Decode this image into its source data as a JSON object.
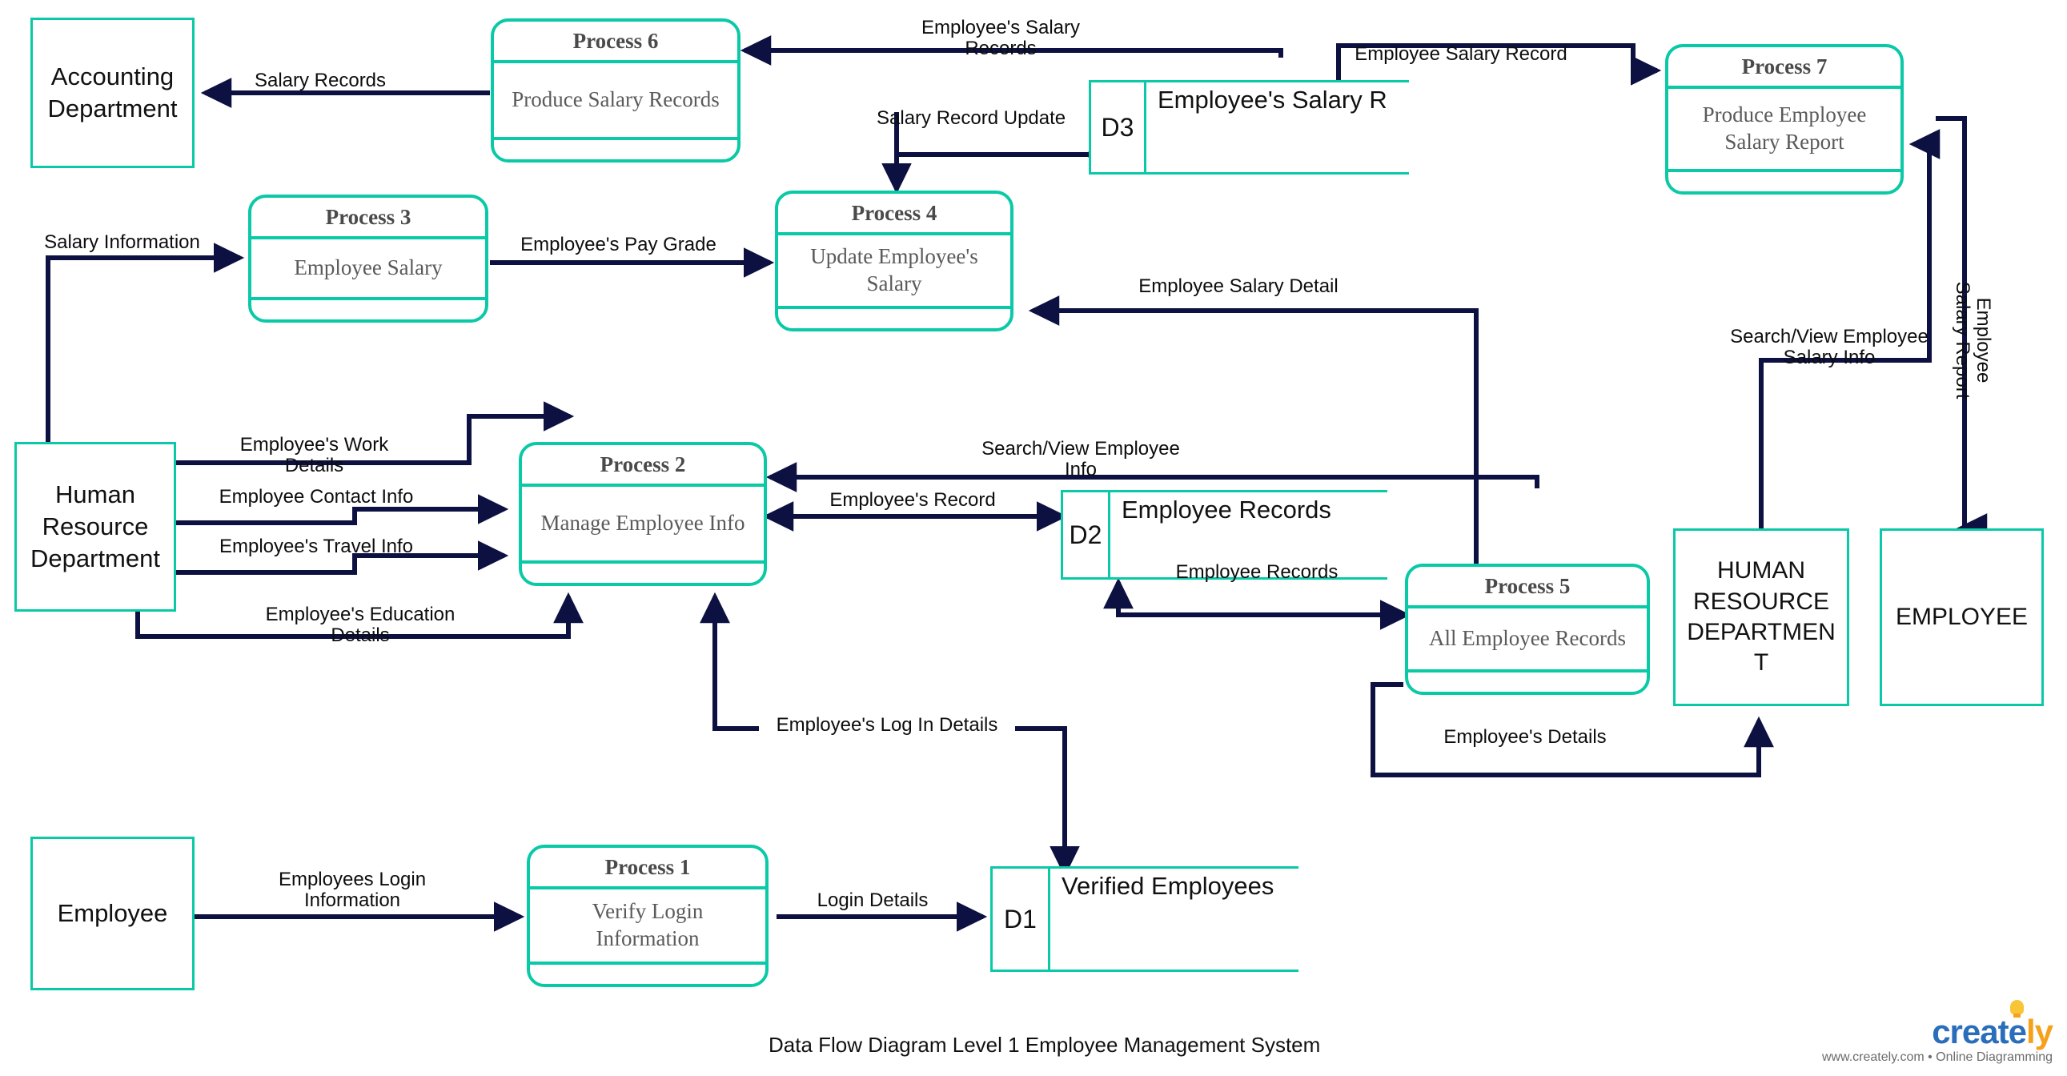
{
  "diagram": {
    "caption": "Data Flow Diagram Level 1 Employee Management System",
    "colors": {
      "shape_border": "#0ac9a6",
      "flow_line": "#0d1141",
      "process_title_text": "#4a4a4a",
      "process_body_text": "#5a5a5a",
      "label_text": "#0d0d0d",
      "background": "#ffffff"
    }
  },
  "entities": [
    {
      "id": "accounting-department",
      "label": "Accounting\nDepartment"
    },
    {
      "id": "human-resource-department",
      "label": "Human\nResource\nDepartment"
    },
    {
      "id": "human-resource-department-caps",
      "label": "HUMAN\nRESOURCE\nDEPARTMEN\nT"
    },
    {
      "id": "employee-caps",
      "label": "EMPLOYEE"
    },
    {
      "id": "employee",
      "label": "Employee"
    }
  ],
  "processes": [
    {
      "id": "process-1",
      "title": "Process 1",
      "body": "Verify Login\nInformation"
    },
    {
      "id": "process-2",
      "title": "Process 2",
      "body": "Manage Employee\nInfo"
    },
    {
      "id": "process-3",
      "title": "Process 3",
      "body": "Employee Salary"
    },
    {
      "id": "process-4",
      "title": "Process 4",
      "body": "Update Employee's\nSalary"
    },
    {
      "id": "process-5",
      "title": "Process 5",
      "body": "All Employee Records"
    },
    {
      "id": "process-6",
      "title": "Process 6",
      "body": "Produce Salary\nRecords"
    },
    {
      "id": "process-7",
      "title": "Process 7",
      "body": "Produce Employee\nSalary Report"
    }
  ],
  "datastores": [
    {
      "id": "d1",
      "code": "D1",
      "name": "Verified Employees"
    },
    {
      "id": "d2",
      "code": "D2",
      "name": "Employee Records"
    },
    {
      "id": "d3",
      "code": "D3",
      "name": "Employee's Salary R"
    }
  ],
  "flows": [
    {
      "id": "salary-records",
      "label": "Salary Records"
    },
    {
      "id": "employees-salary-records",
      "label": "Employee's Salary\nRecords"
    },
    {
      "id": "employee-salary-record",
      "label": "Employee Salary Record"
    },
    {
      "id": "salary-record-update",
      "label": "Salary Record Update"
    },
    {
      "id": "salary-information",
      "label": "Salary Information"
    },
    {
      "id": "employees-pay-grade",
      "label": "Employee's Pay Grade"
    },
    {
      "id": "employee-salary-detail",
      "label": "Employee Salary Detail"
    },
    {
      "id": "search-view-employee-salary-info",
      "label": "Search/View Employee\nSalary Info"
    },
    {
      "id": "employee-salary-report",
      "label": "Employee\nSalary Report"
    },
    {
      "id": "employees-work-details",
      "label": "Employee's Work\nDetails"
    },
    {
      "id": "employee-contact-info",
      "label": "Employee Contact Info"
    },
    {
      "id": "employees-travel-info",
      "label": "Employee's Travel Info"
    },
    {
      "id": "employees-education-details",
      "label": "Employee's Education\nDetails"
    },
    {
      "id": "search-view-employee-info",
      "label": "Search/View Employee\nInfo"
    },
    {
      "id": "employees-record",
      "label": "Employee's Record"
    },
    {
      "id": "employee-records-to-p5",
      "label": "Employee Records"
    },
    {
      "id": "employees-details",
      "label": "Employee's Details"
    },
    {
      "id": "employees-log-in-details",
      "label": "Employee's Log In Details"
    },
    {
      "id": "employees-login-information",
      "label": "Employees Login\nInformation"
    },
    {
      "id": "login-details",
      "label": "Login Details"
    }
  ],
  "watermark": {
    "word_blue": "creat",
    "word_e": "e",
    "word_ly": "ly",
    "tagline": "www.creately.com • Online Diagramming"
  }
}
